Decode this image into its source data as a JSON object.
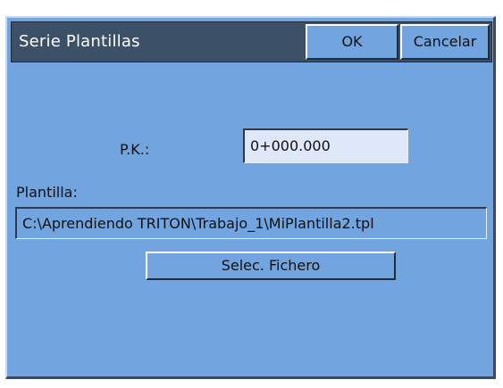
{
  "dialog": {
    "title": "Serie Plantillas",
    "ok_label": "OK",
    "cancel_label": "Cancelar"
  },
  "form": {
    "pk_label": "P.K.:",
    "pk_value": "0+000.000",
    "template_label": "Plantilla:",
    "template_path": "C:\\Aprendiendo TRITON\\Trabajo_1\\MiPlantilla2.tpl",
    "select_file_label": "Selec. Fichero"
  },
  "colors": {
    "dialog_background": "#72a5e0",
    "titlebar_background": "#3c5068",
    "pk_field_background": "#dfe8f8"
  }
}
